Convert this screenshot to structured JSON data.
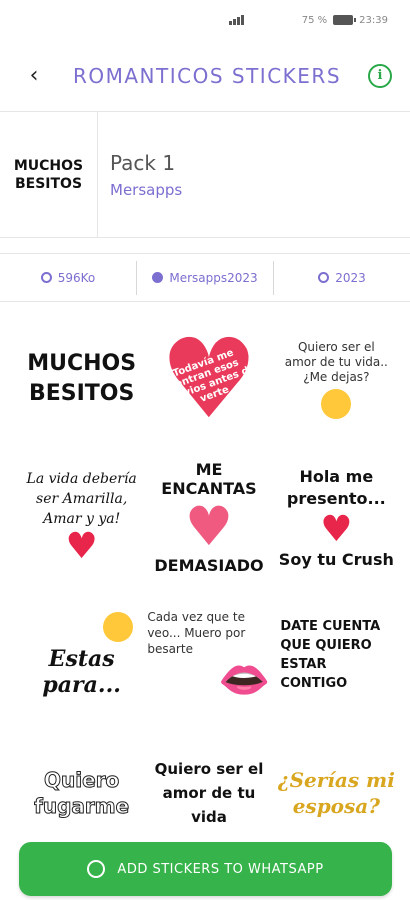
{
  "status_bar": {
    "battery": "75 %",
    "time": "23:39"
  },
  "header": {
    "title": "ROMANTICOS STICKERS"
  },
  "pack": {
    "thumb_text": "MUCHOS BESITOS",
    "name": "Pack 1",
    "publisher": "Mersapps"
  },
  "meta": {
    "size": "596Ko",
    "author": "Mersapps2023",
    "year": "2023"
  },
  "stickers": [
    {
      "text": "MUCHOS BESITOS"
    },
    {
      "text": "Todavía me entran esos nervios antes de verte"
    },
    {
      "text": "Quiero ser el amor de tu vida.. ¿Me dejas?"
    },
    {
      "text": "La vida debería ser Amarilla, Amar y ya!"
    },
    {
      "text_top": "ME ENCANTAS",
      "text_bottom": "DEMASIADO"
    },
    {
      "text_top": "Hola me presento...",
      "text_bottom": "Soy tu Crush"
    },
    {
      "text": "Estas para..."
    },
    {
      "text": "Cada vez que te veo... Muero por besarte"
    },
    {
      "text": "DATE CUENTA QUE QUIERO ESTAR CONTIGO"
    },
    {
      "text": "Quiero fugarme"
    },
    {
      "text": "Quiero ser el amor de tu vida"
    },
    {
      "text": "¿Serías mi esposa?"
    }
  ],
  "add_button": {
    "label": "ADD STICKERS TO WHATSAPP"
  },
  "colors": {
    "accent": "#7b6fd0",
    "primary_green": "#36b34a",
    "heart_red": "#e8254a"
  }
}
